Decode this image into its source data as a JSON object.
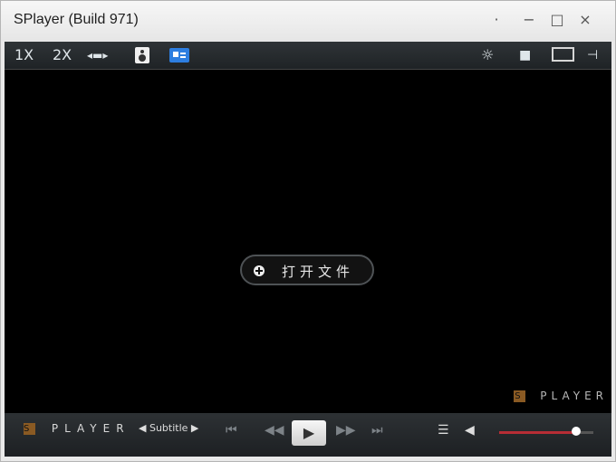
{
  "window": {
    "title": "SPlayer (Build 971)"
  },
  "toolbar": {
    "speed_1x": "1X",
    "speed_2x": "2X"
  },
  "center": {
    "open_file_label": "打开文件"
  },
  "watermark": {
    "logo": "S",
    "text": "PLAYER"
  },
  "bottom": {
    "logo": "S",
    "brand": "PLAYER",
    "subtitle_label": "Subtitle",
    "volume_level": 0.82
  },
  "icons": [
    "aspect-ratio-icon",
    "speaker-icon",
    "display-icon",
    "brightness-icon",
    "camera-icon",
    "fullscreen-icon",
    "pin-icon",
    "previous-icon",
    "rewind-icon",
    "play-icon",
    "fast-forward-icon",
    "next-icon",
    "playlist-icon",
    "volume-icon"
  ]
}
